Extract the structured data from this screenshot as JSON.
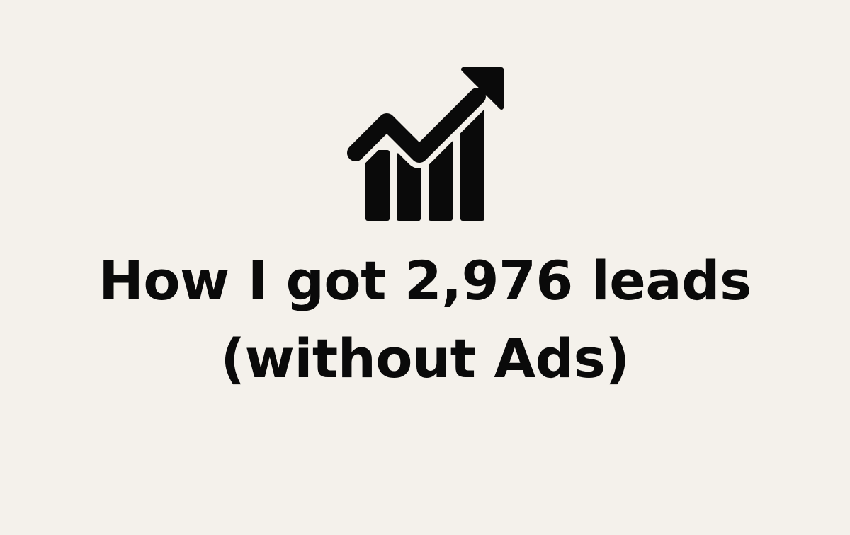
{
  "background_color": "#f4f1eb",
  "text_color": "#0a0a0a",
  "icon": {
    "name": "growth-chart-arrow-icon"
  },
  "headline": {
    "line1": "How I got 2,976 leads",
    "line2": "(without Ads)"
  }
}
